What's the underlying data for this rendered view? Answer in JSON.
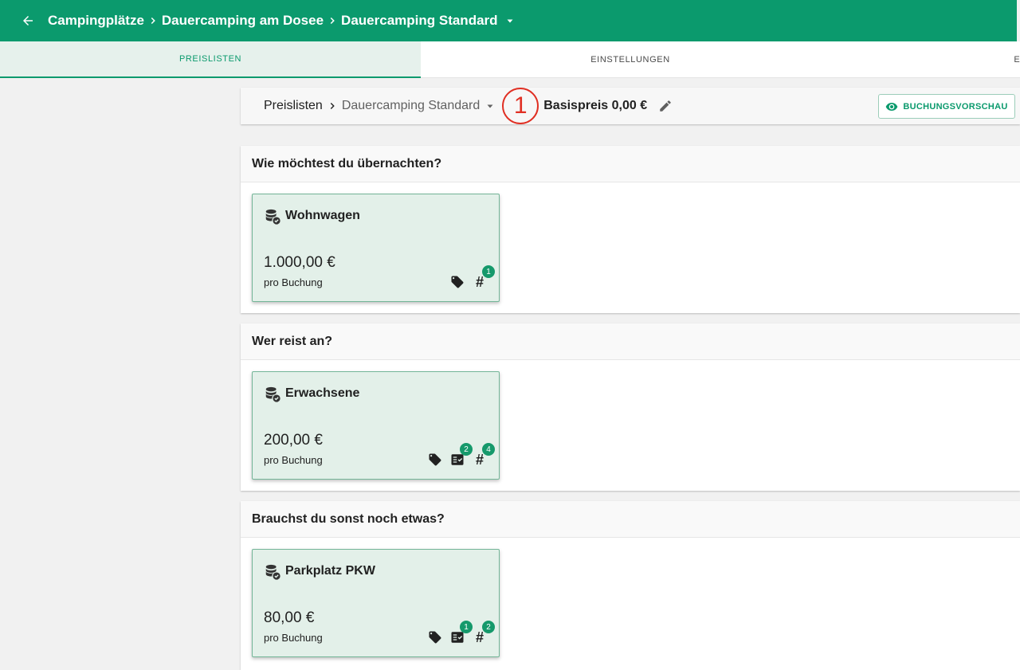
{
  "topbar": {
    "breadcrumbs": [
      "Campingplätze",
      "Dauercamping am Dosee",
      "Dauercamping Standard"
    ],
    "icons": {
      "back": "arrow-left-icon",
      "separator": "chevron-right-icon",
      "dropdown": "caret-down-icon"
    },
    "background": "#0b9a6d"
  },
  "tabs": [
    {
      "label": "PREISLISTEN",
      "active": true
    },
    {
      "label": "EINSTELLUNGEN",
      "active": false
    },
    {
      "label": "EI",
      "active": false
    }
  ],
  "header": {
    "title": "Preislisten",
    "current": "Dauercamping Standard",
    "marker": "1",
    "base_price": "Basispreis 0,00 €",
    "preview_button": "BUCHUNGSVORSCHAU",
    "icons": {
      "edit": "pencil-icon",
      "preview": "eye-icon"
    }
  },
  "sections": [
    {
      "title": "Wie möchtest du übernachten?",
      "item": {
        "name": "Wohnwagen",
        "price": "1.000,00 €",
        "unit": "pro Buchung",
        "checklist_count": null,
        "hash_count": "1"
      }
    },
    {
      "title": "Wer reist an?",
      "item": {
        "name": "Erwachsene",
        "price": "200,00 €",
        "unit": "pro Buchung",
        "checklist_count": "2",
        "hash_count": "4"
      }
    },
    {
      "title": "Brauchst du sonst noch etwas?",
      "item": {
        "name": "Parkplatz PKW",
        "price": "80,00 €",
        "unit": "pro Buchung",
        "checklist_count": "1",
        "hash_count": "2"
      }
    }
  ],
  "tile_icons": {
    "price": "coins-check-icon",
    "tag": "tag-icon",
    "checklist": "checklist-icon",
    "hash": "hash-icon"
  },
  "colors": {
    "accent": "#0b9a6d",
    "tile_bg": "#e3f0e9",
    "marker": "#e02f23"
  }
}
